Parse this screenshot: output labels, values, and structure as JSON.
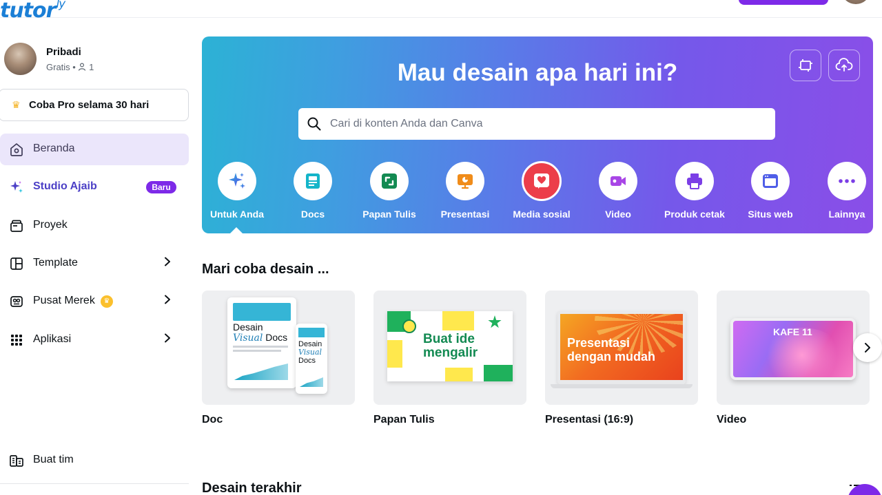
{
  "watermark": {
    "text": "tutor",
    "suffix": "ly"
  },
  "profile": {
    "name": "Pribadi",
    "plan": "Gratis",
    "members": "1"
  },
  "pro_button": {
    "label": "Coba Pro selama 30 hari"
  },
  "nav": [
    {
      "id": "home",
      "label": "Beranda",
      "icon": "home-icon"
    },
    {
      "id": "studio",
      "label": "Studio Ajaib",
      "icon": "sparkle-icon",
      "badge": "Baru"
    },
    {
      "id": "projects",
      "label": "Proyek",
      "icon": "folder-icon"
    },
    {
      "id": "template",
      "label": "Template",
      "icon": "template-icon"
    },
    {
      "id": "brand",
      "label": "Pusat Merek",
      "icon": "brand-kit-icon"
    },
    {
      "id": "apps",
      "label": "Aplikasi",
      "icon": "grid-icon"
    }
  ],
  "create_team": {
    "label": "Buat tim"
  },
  "hero": {
    "title": "Mau desain apa hari ini?",
    "search_placeholder": "Cari di konten Anda dan Canva",
    "categories": [
      {
        "label": "Untuk Anda",
        "icon": "sparkle-icon",
        "color": "#ffffff"
      },
      {
        "label": "Docs",
        "icon": "doc-icon",
        "color": "#14b5c9"
      },
      {
        "label": "Papan Tulis",
        "icon": "whiteboard-icon",
        "color": "#138a52"
      },
      {
        "label": "Presentasi",
        "icon": "presentation-icon",
        "color": "#f08c1a"
      },
      {
        "label": "Media sosial",
        "icon": "heart-icon",
        "color": "#ec3e4a"
      },
      {
        "label": "Video",
        "icon": "video-icon",
        "color": "#a846e6"
      },
      {
        "label": "Produk cetak",
        "icon": "printer-icon",
        "color": "#7b3ee6"
      },
      {
        "label": "Situs web",
        "icon": "website-icon",
        "color": "#4f5ee8"
      },
      {
        "label": "Lainnya",
        "icon": "more-icon",
        "color": "#7b3ee6"
      }
    ]
  },
  "try_design": {
    "title": "Mari coba desain ...",
    "cards": [
      {
        "label": "Doc",
        "thumb_title_1": "Desain",
        "thumb_title_2": "Visual",
        "thumb_title_3": "Docs"
      },
      {
        "label": "Papan Tulis",
        "thumb_title_1": "Buat ide",
        "thumb_title_2": "mengalir"
      },
      {
        "label": "Presentasi (16:9)",
        "thumb_title_1": "Presentasi",
        "thumb_title_2": "dengan mudah"
      },
      {
        "label": "Video",
        "thumb_title_1": "KAFE 11"
      }
    ]
  },
  "recent": {
    "title": "Desain terakhir"
  },
  "colors": {
    "accent": "#7d2ae8",
    "active_bg": "#ebe6fb"
  }
}
